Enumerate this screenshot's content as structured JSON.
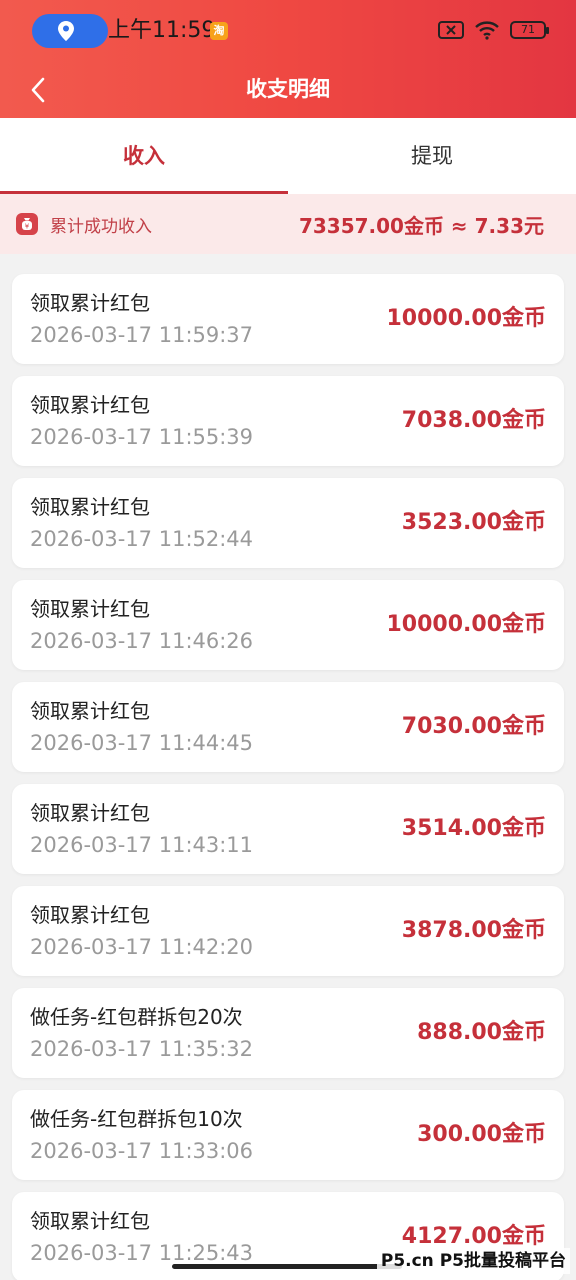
{
  "status_bar": {
    "time": "上午11:59",
    "app_badge": "淘",
    "battery": "71"
  },
  "nav": {
    "title": "收支明细"
  },
  "tabs": [
    {
      "label": "收入",
      "active": true
    },
    {
      "label": "提现",
      "active": false
    }
  ],
  "summary": {
    "label": "累计成功收入",
    "value": "73357.00金币 ≈ 7.33元"
  },
  "records": [
    {
      "title": "领取累计红包",
      "time": "2026-03-17 11:59:37",
      "amount": "10000.00金币"
    },
    {
      "title": "领取累计红包",
      "time": "2026-03-17 11:55:39",
      "amount": "7038.00金币"
    },
    {
      "title": "领取累计红包",
      "time": "2026-03-17 11:52:44",
      "amount": "3523.00金币"
    },
    {
      "title": "领取累计红包",
      "time": "2026-03-17 11:46:26",
      "amount": "10000.00金币"
    },
    {
      "title": "领取累计红包",
      "time": "2026-03-17 11:44:45",
      "amount": "7030.00金币"
    },
    {
      "title": "领取累计红包",
      "time": "2026-03-17 11:43:11",
      "amount": "3514.00金币"
    },
    {
      "title": "领取累计红包",
      "time": "2026-03-17 11:42:20",
      "amount": "3878.00金币"
    },
    {
      "title": "做任务-红包群拆包20次",
      "time": "2026-03-17 11:35:32",
      "amount": "888.00金币"
    },
    {
      "title": "做任务-红包群拆包10次",
      "time": "2026-03-17 11:33:06",
      "amount": "300.00金币"
    },
    {
      "title": "领取累计红包",
      "time": "2026-03-17 11:25:43",
      "amount": "4127.00金币"
    }
  ],
  "watermark": "P5.cn P5批量投稿平台",
  "colors": {
    "accent": "#c5303a",
    "header": "#ef4842",
    "summary_bg": "#fbe9e9"
  }
}
